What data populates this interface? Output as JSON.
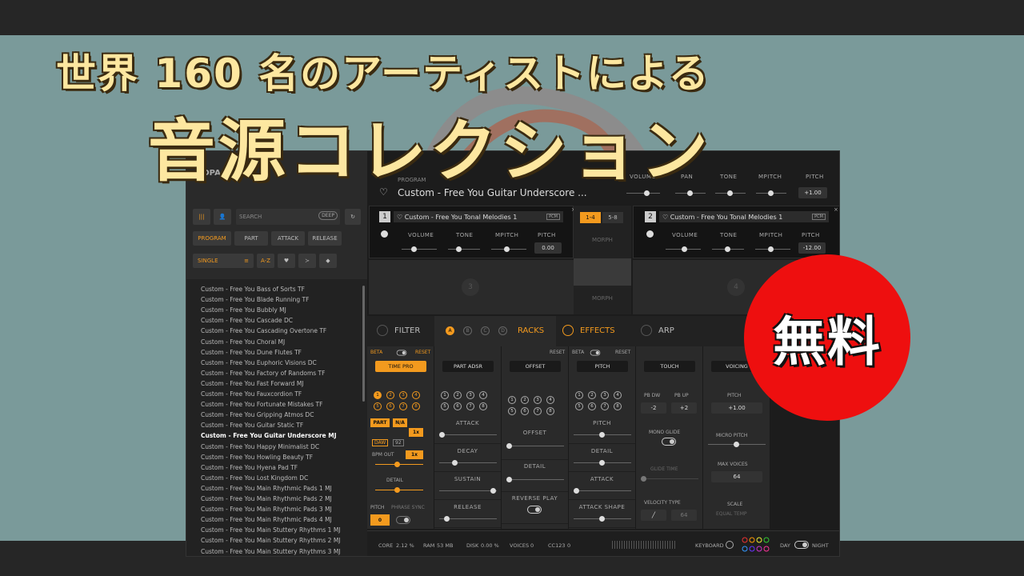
{
  "headline": {
    "line1": "世界 160 名のアーティストによる",
    "line2": "音源コレクション"
  },
  "badge": "無料",
  "brand": "NDPA",
  "sidebar": {
    "search_placeholder": "SEARCH",
    "deep_label": "DEEP",
    "filters": [
      "PROGRAM",
      "PART",
      "ATTACK",
      "RELEASE"
    ],
    "single_label": "SINGLE",
    "az_label": "A-Z",
    "presets": [
      "Custom - Free You Bass of Sorts TF",
      "Custom - Free You Blade Running TF",
      "Custom - Free You Bubbly MJ",
      "Custom - Free You Cascade DC",
      "Custom - Free You Cascading Overtone TF",
      "Custom - Free You Choral MJ",
      "Custom - Free You Dune Flutes TF",
      "Custom - Free You Euphoric Visions DC",
      "Custom - Free You Factory of Randoms TF",
      "Custom - Free You Fast Forward MJ",
      "Custom - Free You Fauxcordion TF",
      "Custom - Free You Fortunate Mistakes TF",
      "Custom - Free You Gripping Atmos DC",
      "Custom - Free You Guitar Static TF",
      "Custom - Free You Guitar Underscore MJ",
      "Custom - Free You Happy Minimalist DC",
      "Custom - Free You Howling Beauty TF",
      "Custom - Free You Hyena Pad TF",
      "Custom - Free You Lost Kingdom DC",
      "Custom - Free You Main Rhythmic Pads 1 MJ",
      "Custom - Free You Main Rhythmic Pads 2 MJ",
      "Custom - Free You Main Rhythmic Pads 3 MJ",
      "Custom - Free You Main Rhythmic Pads 4 MJ",
      "Custom - Free You Main Stuttery Rhythms 1 MJ",
      "Custom - Free You Main Stuttery Rhythms 2 MJ",
      "Custom - Free You Main Stuttery Rhythms 3 MJ"
    ],
    "selected_index": 14
  },
  "program": {
    "label": "PROGRAM",
    "title": "Custom - Free You Guitar Underscore ...",
    "knobs": [
      "VOLUME",
      "PAN",
      "TONE",
      "MPITCH",
      "PITCH"
    ],
    "pitch_value": "+1.00"
  },
  "part1": {
    "num": "1",
    "name": "Custom - Free You Tonal Melodies 1",
    "badge": "PCM",
    "knobs": [
      "VOLUME",
      "TONE",
      "MPITCH",
      "PITCH"
    ],
    "pitch_value": "0.00"
  },
  "part2": {
    "num": "2",
    "name": "Custom - Free You Tonal Melodies 1",
    "badge": "PCM",
    "knobs": [
      "VOLUME",
      "TONE",
      "MPITCH",
      "PITCH"
    ],
    "pitch_value": "-12.00"
  },
  "part3_num": "3",
  "part4_num": "4",
  "morph": {
    "tab_a": "1-4",
    "tab_b": "5-8",
    "label": "MORPH"
  },
  "tabs": {
    "filter": "FILTER",
    "racks": "RACKS",
    "effects": "EFFECTS",
    "arp": "ARP",
    "abcd": [
      "A",
      "B",
      "C",
      "D"
    ]
  },
  "panels": {
    "beta": "BETA",
    "reset": "RESET",
    "timepro": "TIME PRO",
    "part_btn": "PART",
    "na_btn": "N/A",
    "mult1": "1x",
    "daw": "DAW",
    "bpm_val": "92",
    "bpm_out": "BPM OUT",
    "mult2": "1x",
    "detail": "DETAIL",
    "pitch": "PITCH",
    "phrase_sync": "PHRASE SYNC",
    "pitch_val": "0",
    "nums": [
      "1",
      "2",
      "3",
      "4",
      "5",
      "6",
      "7",
      "8"
    ],
    "part_adsr": "PART ADSR",
    "attack": "ATTACK",
    "decay": "DECAY",
    "sustain": "SUSTAIN",
    "release": "RELEASE",
    "offset_dd": "OFFSET",
    "offset": "OFFSET",
    "detail2": "DETAIL",
    "reverse_play": "REVERSE PLAY",
    "pitch_dd": "PITCH",
    "pitch2": "PITCH",
    "detail3": "DETAIL",
    "attack2": "ATTACK",
    "attack_shape": "ATTACK SHAPE",
    "touch": "TOUCH",
    "pb_dw": "PB DW",
    "pb_up": "PB UP",
    "pb_dw_val": "-2",
    "pb_up_val": "+2",
    "mono_glide": "MONO GLIDE",
    "glide_time": "GLIDE TIME",
    "velocity_type": "VELOCITY TYPE",
    "vel_val": "64",
    "voicing": "VOICING",
    "vpitch": "PITCH",
    "vpitch_val": "+1.00",
    "micro_pitch": "MICRO PITCH",
    "max_voices": "MAX VOICES",
    "max_voices_val": "64",
    "scale": "SCALE",
    "equal_temp": "EQUAL TEMP"
  },
  "status": {
    "core_label": "CORE",
    "core": "2.12 %",
    "ram_label": "RAM",
    "ram": "53 MB",
    "disk_label": "DISK",
    "disk": "0.00 %",
    "voices_label": "VOICES",
    "voices": "0",
    "cc_label": "CC123",
    "cc": "0",
    "keyboard": "KEYBOARD",
    "day": "DAY",
    "night": "NIGHT"
  },
  "colors": {
    "accent": "#f39a1e",
    "badge": "#ee0f0f",
    "headline": "#fde7a0"
  }
}
